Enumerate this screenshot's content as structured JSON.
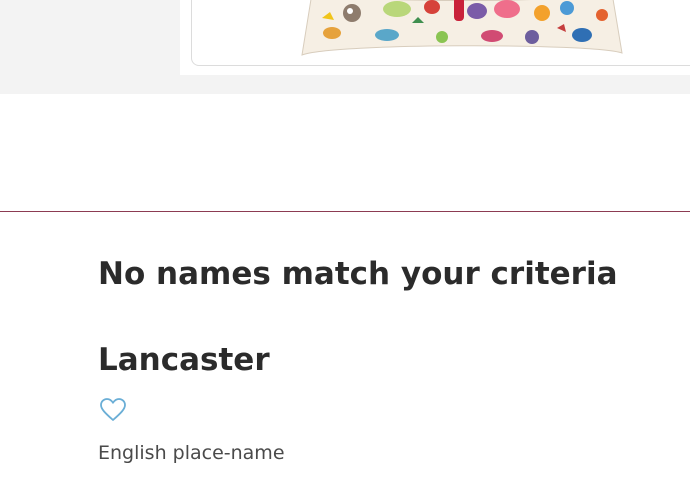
{
  "results": {
    "empty_message": "No names match your criteria"
  },
  "name_card": {
    "name": "Lancaster",
    "origin": "English place-name",
    "favorite_icon": "heart-outline-icon"
  },
  "colors": {
    "divider": "#8c3b52",
    "heart": "#6aaed6",
    "text": "#2b2b2b"
  }
}
